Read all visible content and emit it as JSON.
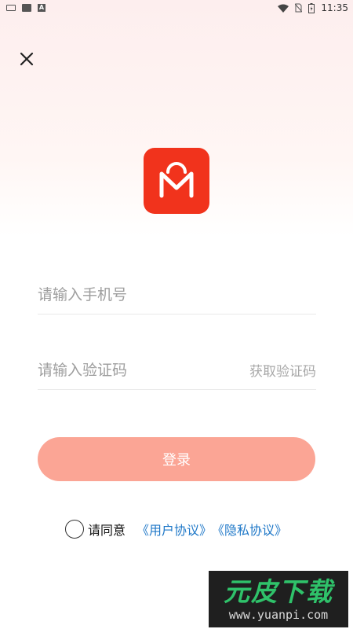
{
  "status_bar": {
    "time": "11:35",
    "icons": [
      "keyboard-icon",
      "image-icon",
      "a-icon",
      "wifi-icon",
      "no-sim-icon",
      "battery-charging-icon"
    ],
    "a_label": "A"
  },
  "close": {
    "icon": "close-icon"
  },
  "logo": {
    "icon": "app-logo-m",
    "color": "#f1331c"
  },
  "phone": {
    "placeholder": "请输入手机号",
    "value": ""
  },
  "code": {
    "placeholder": "请输入验证码",
    "value": "",
    "get_code_label": "获取验证码"
  },
  "login": {
    "label": "登录",
    "color": "#fba595"
  },
  "agreement": {
    "prefix": "请同意",
    "user_agreement": "《用户协议》",
    "privacy_policy": "《隐私协议》",
    "link_color": "#1f78c8"
  },
  "watermark": {
    "title": "元皮下载",
    "url": "www.yuanpi.com"
  }
}
